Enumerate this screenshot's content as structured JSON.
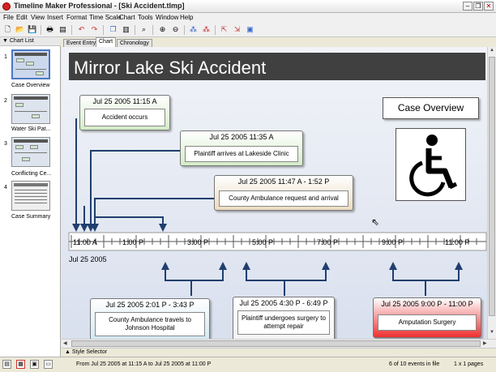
{
  "window": {
    "title": "Timeline Maker Professional - [Ski Accident.tlmp]",
    "minimize": "–",
    "restore": "❐",
    "close": "✕"
  },
  "menu": [
    "File",
    "Edit",
    "View",
    "Insert",
    "Format",
    "Time Scale",
    "Chart",
    "Tools",
    "Window",
    "Help"
  ],
  "toolbar_icons": [
    "new-icon",
    "open-icon",
    "save-icon",
    "print-icon",
    "print-preview-icon",
    "undo-icon",
    "redo-icon",
    "copy-icon",
    "paste-icon",
    "find-icon",
    "zoom-in-icon",
    "zoom-out-icon",
    "expand-icon",
    "collapse-icon",
    "export-icon",
    "publish-icon",
    "present-icon"
  ],
  "chart_list": {
    "header": "▼ Chart List",
    "items": [
      {
        "num": "1",
        "label": "Case Overview"
      },
      {
        "num": "2",
        "label": "Water Ski Pat..."
      },
      {
        "num": "3",
        "label": "Conflicting Ce..."
      },
      {
        "num": "4",
        "label": "Case Summary"
      }
    ]
  },
  "tabs": [
    "Event Entry",
    "Chart",
    "Chronology"
  ],
  "chart": {
    "title": "Mirror Lake Ski Accident",
    "case_label": "Case Overview",
    "icon": "wheelchair-icon",
    "events_above": [
      {
        "date": "Jul 25 2005 11:15 A",
        "desc": "Accident occurs",
        "color": "#d4ecc8"
      },
      {
        "date": "Jul 25 2005 11:35 A",
        "desc": "Plaintiff arrives at Lakeside Clinic",
        "color": "#d4ecc8"
      },
      {
        "date": "Jul 25 2005 11:47 A - 1:52 P",
        "desc": "County Ambulance request and arrival",
        "color": "#ecdcc0"
      }
    ],
    "events_below": [
      {
        "date": "Jul 25 2005 2:01 P - 3:43 P",
        "desc": "County Ambulance travels to Johnson Hospital",
        "color": "#c8e6ee"
      },
      {
        "date": "Jul 25 2005 4:30 P - 6:49 P",
        "desc": "Plaintiff undergoes surgery to attempt repair",
        "color": "#f2f2f2"
      },
      {
        "date": "Jul 25 2005 9:00 P - 11:00 P",
        "desc": "Amputation Surgery",
        "color": "#ee3030"
      }
    ],
    "axis_labels": [
      "11:00 A",
      "1:00 P",
      "3:00 P",
      "5:00 P",
      "7:00 P",
      "9:00 P",
      "11:00 P"
    ],
    "axis_date": "Jul 25 2005"
  },
  "style_selector": "▲ Style Selector",
  "status": {
    "range": "From Jul 25 2005 at 11:15 A to Jul 25 2005 at 11:00 P",
    "events": "6 of 10 events in file",
    "pages": "1 x 1 pages"
  }
}
